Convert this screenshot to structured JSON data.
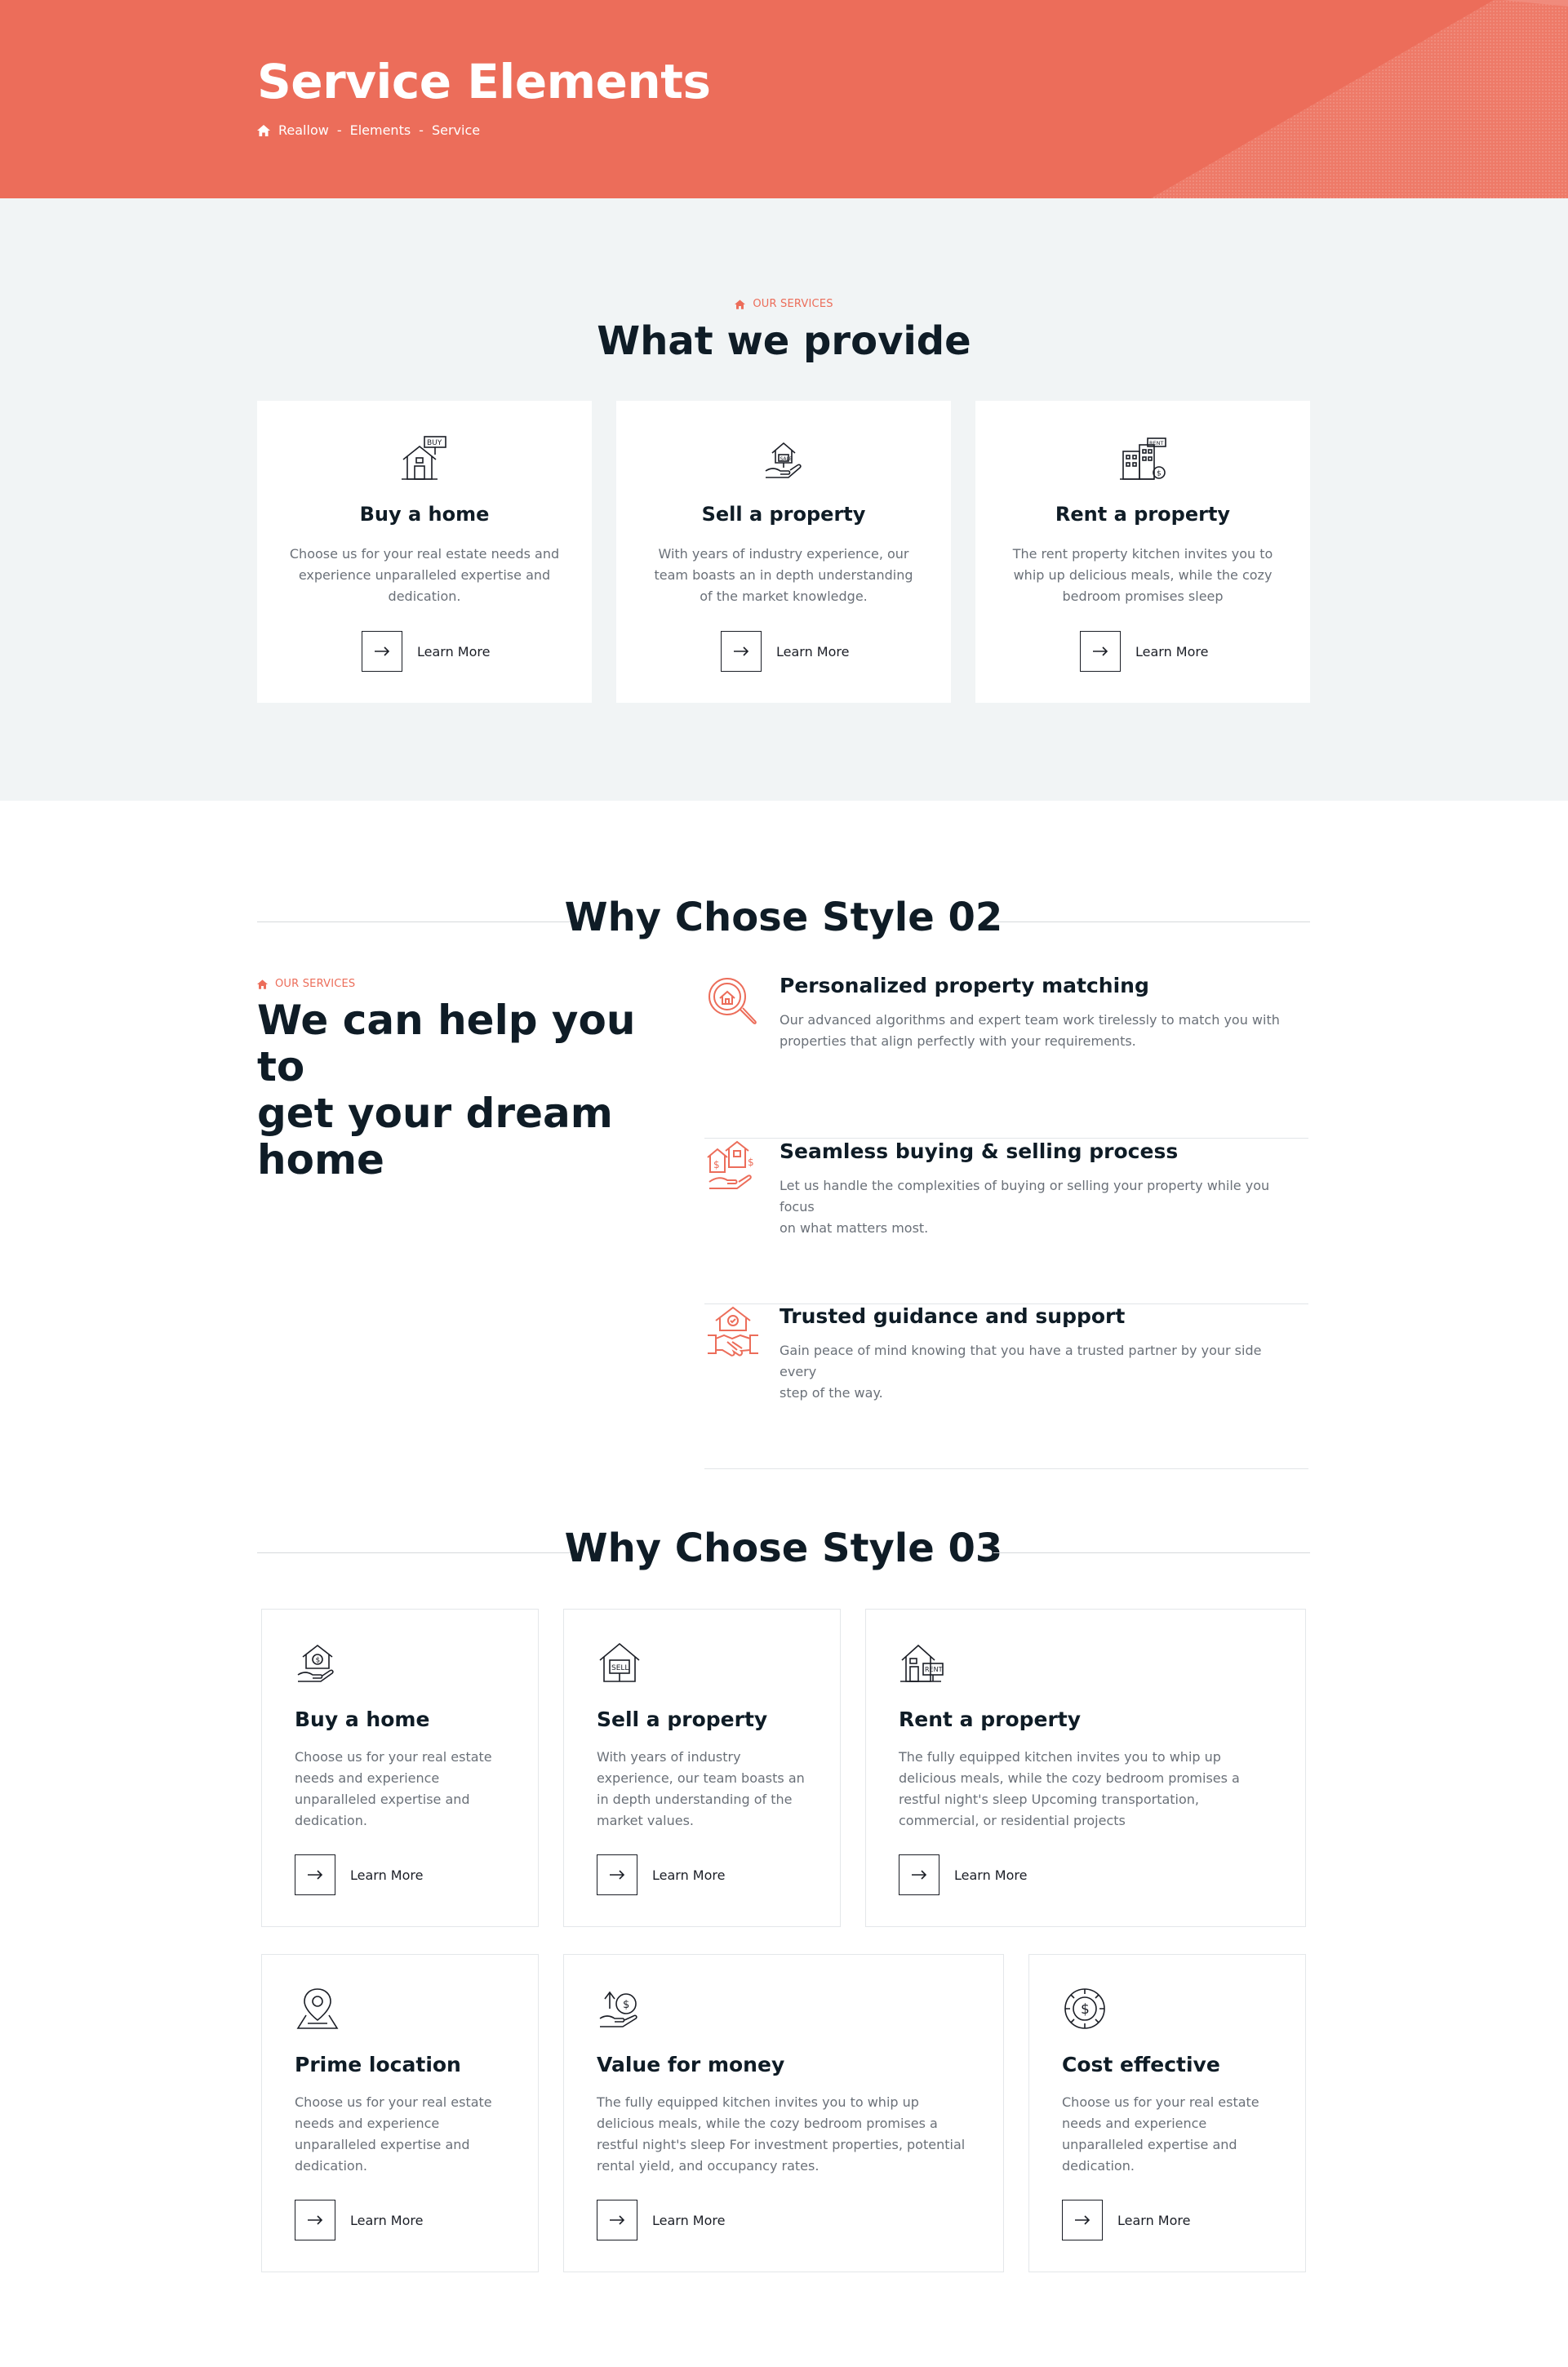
{
  "colors": {
    "accent": "#ec6d5a",
    "heading": "#0f1c26",
    "body_text": "#6a7078",
    "section_bg": "#f1f4f5"
  },
  "hero": {
    "title": "Service Elements",
    "breadcrumb": {
      "home_icon": "home-icon",
      "items": [
        "Reallow",
        "Elements",
        "Service"
      ],
      "separator": "-"
    }
  },
  "section1": {
    "eyebrow": "OUR SERVICES",
    "title": "What we provide",
    "cards": [
      {
        "icon": "buy-house-icon",
        "title": "Buy a home",
        "desc_lines": [
          "Choose us for your real estate needs and",
          "experience unparalleled expertise and",
          "dedication."
        ],
        "cta": "Learn More"
      },
      {
        "icon": "sell-house-hand-icon",
        "title": "Sell a property",
        "desc_lines": [
          "With years of industry experience, our",
          "team boasts an in depth understanding",
          "of the market knowledge."
        ],
        "cta": "Learn More"
      },
      {
        "icon": "rent-building-icon",
        "title": "Rent a property",
        "desc_lines": [
          "The rent property kitchen invites you to",
          "whip up delicious meals, while the cozy",
          "bedroom promises sleep"
        ],
        "cta": "Learn More"
      }
    ]
  },
  "section2": {
    "heading": "Why Chose Style 02",
    "eyebrow": "OUR SERVICES",
    "title_lines": [
      "We can help you to",
      "get your dream",
      "home"
    ],
    "features": [
      {
        "icon": "search-house-icon",
        "title": "Personalized property matching",
        "desc_lines": [
          "Our advanced algorithms and expert team work tirelessly to match you with",
          "properties that align perfectly with your requirements."
        ]
      },
      {
        "icon": "buy-sell-houses-icon",
        "title": "Seamless buying & selling process",
        "desc_lines": [
          "Let us handle the complexities of buying or selling your property while you focus",
          "on what matters most."
        ]
      },
      {
        "icon": "handshake-house-icon",
        "title": "Trusted guidance and support",
        "desc_lines": [
          "Gain peace of mind knowing that you have a trusted partner by your side every",
          "step of the way."
        ]
      }
    ]
  },
  "section3": {
    "heading": "Why Chose Style 03",
    "cards": [
      {
        "icon": "house-dollar-hand-icon",
        "title": "Buy a home",
        "desc_lines": [
          "Choose us for your real estate",
          "needs and experience",
          "unparalleled expertise and",
          "dedication."
        ],
        "cta": "Learn More"
      },
      {
        "icon": "house-sell-sign-icon",
        "title": "Sell a property",
        "desc_lines": [
          "With years of industry",
          "experience, our team boasts an",
          "in depth understanding of the",
          "market values."
        ],
        "cta": "Learn More"
      },
      {
        "icon": "house-rent-sign-icon",
        "title": "Rent a property",
        "desc_lines": [
          "The fully equipped kitchen invites you to whip up",
          "delicious meals, while the cozy bedroom promises a",
          "restful night's sleep Upcoming transportation,",
          "commercial, or residential projects"
        ],
        "cta": "Learn More"
      },
      {
        "icon": "map-pin-icon",
        "title": "Prime location",
        "desc_lines": [
          "Choose us for your real estate",
          "needs and experience",
          "unparalleled expertise and",
          "dedication."
        ],
        "cta": "Learn More"
      },
      {
        "icon": "money-growth-icon",
        "title": "Value for money",
        "desc_lines": [
          "The fully equipped kitchen invites you to whip up",
          "delicious meals, while the cozy bedroom promises a",
          "restful night's sleep For investment properties, potential",
          "rental yield, and occupancy rates."
        ],
        "cta": "Learn More"
      },
      {
        "icon": "dollar-gear-icon",
        "title": "Cost effective",
        "desc_lines": [
          "Choose us for your real estate",
          "needs and experience",
          "unparalleled expertise and",
          "dedication."
        ],
        "cta": "Learn More"
      }
    ]
  }
}
